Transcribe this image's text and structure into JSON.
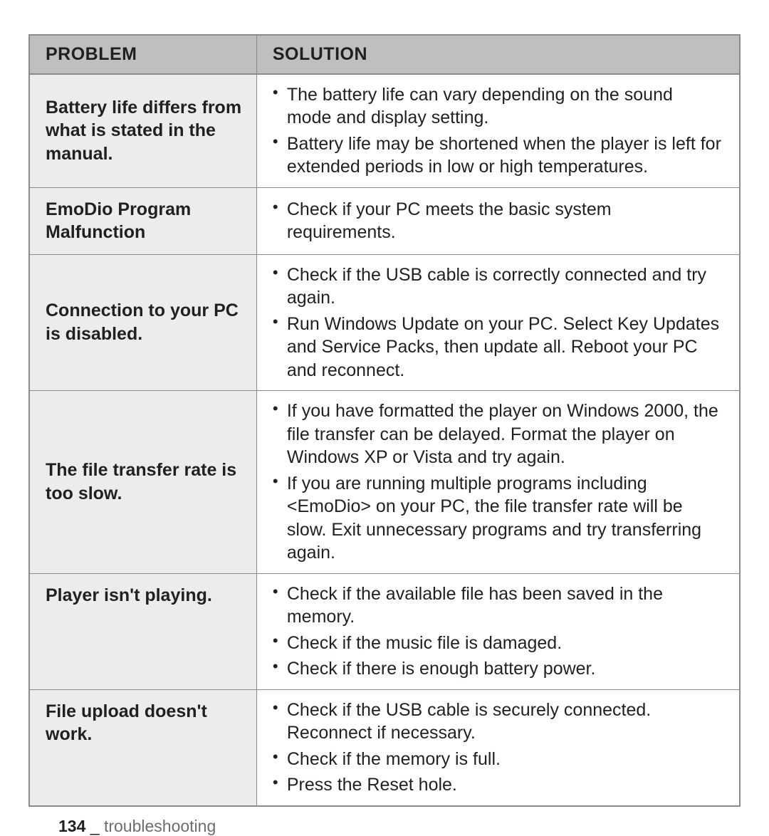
{
  "headers": {
    "problem": "PROBLEM",
    "solution": "SOLUTION"
  },
  "rows": [
    {
      "problem": "Battery life differs from what is stated in the manual.",
      "solutions": [
        "The battery life can vary depending on the sound mode and display setting.",
        "Battery life may be shortened when the player is left for extended periods in low or high temperatures."
      ]
    },
    {
      "problem": "EmoDio Program Malfunction",
      "solutions": [
        "Check if your PC meets the basic system requirements."
      ]
    },
    {
      "problem": "Connection to your PC is disabled.",
      "solutions": [
        "Check if the USB cable is correctly connected and try again.",
        "Run Windows Update on your PC. Select Key Updates and Service Packs, then update all. Reboot your PC and reconnect."
      ]
    },
    {
      "problem": "The file transfer rate is too slow.",
      "solutions": [
        "If you have formatted the player on Windows 2000, the file transfer can be delayed. Format the player on Windows XP or Vista and try again.",
        "If you are running multiple programs including <EmoDio> on your PC, the file transfer rate will be slow. Exit unnecessary programs and try transferring again."
      ]
    },
    {
      "problem": "Player isn't playing.",
      "solutions": [
        "Check if the available file has been saved in the memory.",
        "Check if the music file is damaged.",
        "Check if there is enough battery power."
      ],
      "align_top": true
    },
    {
      "problem": "File upload doesn't work.",
      "solutions": [
        "Check if the USB cable is securely connected. Reconnect if necessary.",
        "Check if the memory is full.",
        "Press the Reset hole."
      ],
      "align_top": true
    }
  ],
  "footer": {
    "page": "134",
    "sep": " _ ",
    "section": "troubleshooting"
  }
}
